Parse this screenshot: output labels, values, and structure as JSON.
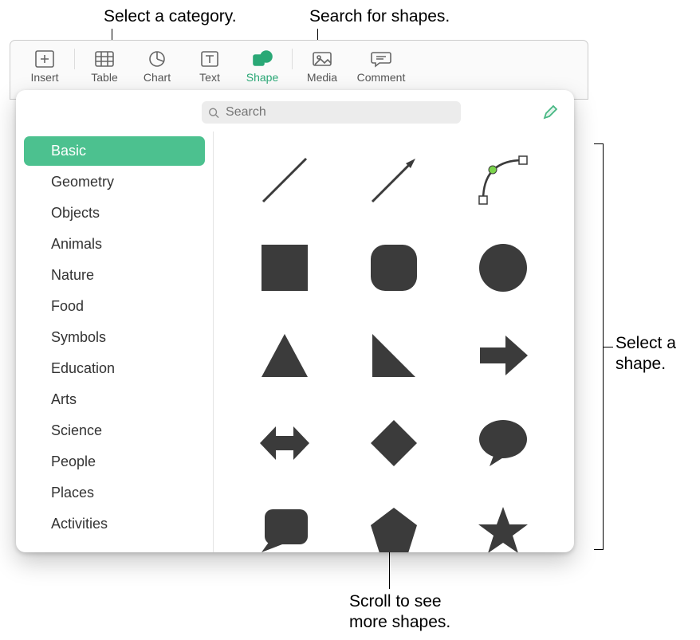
{
  "callouts": {
    "category": "Select a category.",
    "search": "Search for shapes.",
    "select_shape_l1": "Select a",
    "select_shape_l2": "shape.",
    "scroll_l1": "Scroll to see",
    "scroll_l2": "more shapes."
  },
  "toolbar": {
    "items": [
      {
        "label": "Insert",
        "icon": "insert-icon"
      },
      {
        "label": "Table",
        "icon": "table-icon"
      },
      {
        "label": "Chart",
        "icon": "chart-icon"
      },
      {
        "label": "Text",
        "icon": "text-icon"
      },
      {
        "label": "Shape",
        "icon": "shape-icon",
        "active": true
      },
      {
        "label": "Media",
        "icon": "media-icon"
      },
      {
        "label": "Comment",
        "icon": "comment-icon"
      }
    ]
  },
  "search": {
    "placeholder": "Search"
  },
  "categories": [
    "Basic",
    "Geometry",
    "Objects",
    "Animals",
    "Nature",
    "Food",
    "Symbols",
    "Education",
    "Arts",
    "Science",
    "People",
    "Places",
    "Activities"
  ],
  "selected_category": "Basic",
  "shapes": [
    "line",
    "arrow-line",
    "curve",
    "square",
    "rounded-square",
    "circle",
    "triangle",
    "right-triangle",
    "arrow-right",
    "double-arrow",
    "diamond",
    "speech-bubble",
    "callout-box",
    "pentagon",
    "star"
  ],
  "colors": {
    "shape_fill": "#3b3b3b",
    "accent": "#4cc18f"
  }
}
